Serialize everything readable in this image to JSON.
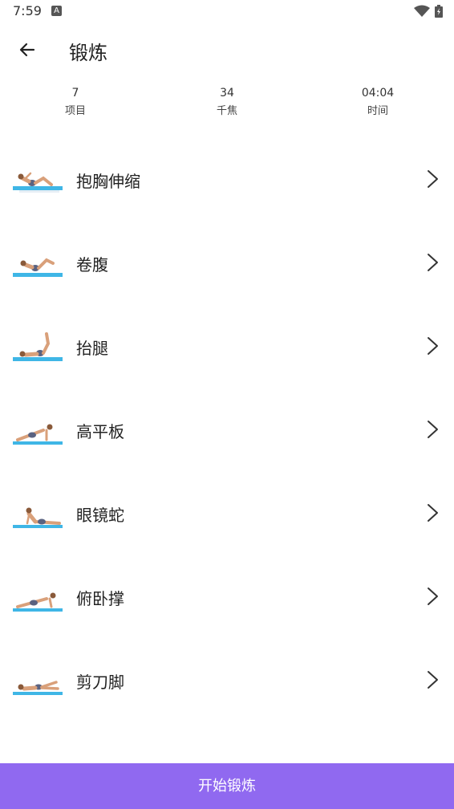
{
  "status_bar": {
    "time": "7:59",
    "badge": "A"
  },
  "header": {
    "title": "锻炼"
  },
  "stats": [
    {
      "value": "7",
      "label": "项目"
    },
    {
      "value": "34",
      "label": "千焦"
    },
    {
      "value": "04:04",
      "label": "时间"
    }
  ],
  "exercises": [
    {
      "label": "抱胸伸缩"
    },
    {
      "label": "卷腹"
    },
    {
      "label": "抬腿"
    },
    {
      "label": "高平板"
    },
    {
      "label": "眼镜蛇"
    },
    {
      "label": "俯卧撑"
    },
    {
      "label": "剪刀脚"
    }
  ],
  "footer": {
    "start_label": "开始锻炼"
  },
  "colors": {
    "accent": "#9069f0",
    "mat": "#3fb6e6",
    "skin": "#d9a07a",
    "shorts": "#5a6280"
  }
}
